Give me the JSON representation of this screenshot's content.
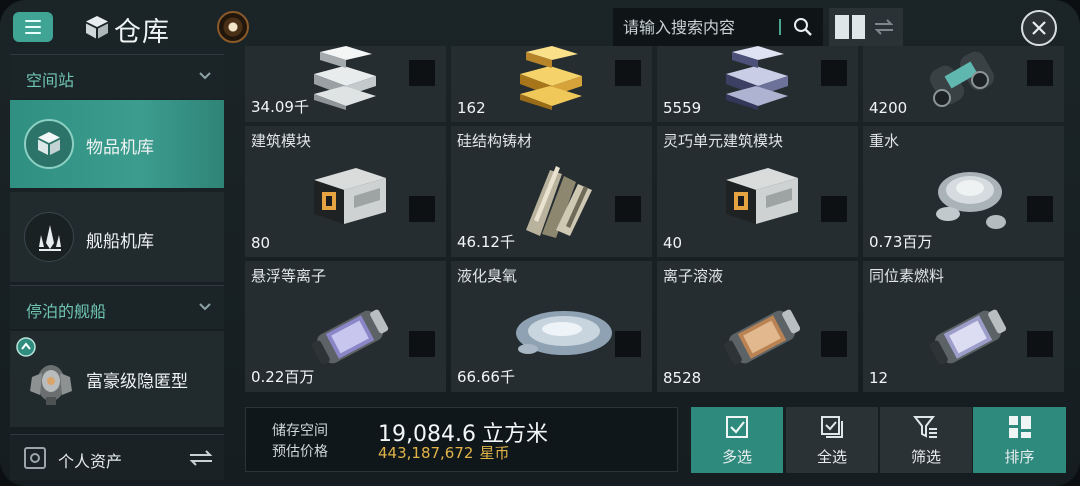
{
  "header": {
    "title": "仓库",
    "search_placeholder": "请输入搜索内容",
    "icons": [
      "menu-icon",
      "cube-icon",
      "radar-icon",
      "search-icon",
      "grid-view-icon",
      "swap-view-icon",
      "close-icon"
    ]
  },
  "sidebar": {
    "section1": "空间站",
    "item_warehouse": "物品机库",
    "item_ships": "舰船机库",
    "section2": "停泊的舰船",
    "item_docked": "富豪级隐匿型",
    "assets": "个人资产"
  },
  "items": [
    {
      "name": "",
      "qty": "34.09千",
      "art": "silver-ingot-icon"
    },
    {
      "name": "",
      "qty": "162",
      "art": "gold-ingot-icon"
    },
    {
      "name": "",
      "qty": "5559",
      "art": "dark-ingot-icon"
    },
    {
      "name": "",
      "qty": "4200",
      "art": "component-icon"
    },
    {
      "name": "建筑模块",
      "qty": "80",
      "art": "module-icon"
    },
    {
      "name": "硅结构铸材",
      "qty": "46.12千",
      "art": "crystal-icon"
    },
    {
      "name": "灵巧单元建筑模块",
      "qty": "40",
      "art": "module-icon"
    },
    {
      "name": "重水",
      "qty": "0.73百万",
      "art": "water-drop-icon"
    },
    {
      "name": "悬浮等离子",
      "qty": "0.22百万",
      "art": "canister-icon"
    },
    {
      "name": "液化臭氧",
      "qty": "66.66千",
      "art": "liquid-puddle-icon"
    },
    {
      "name": "离子溶液",
      "qty": "8528",
      "art": "canister-icon"
    },
    {
      "name": "同位素燃料",
      "qty": "12",
      "art": "canister-icon"
    }
  ],
  "storage": {
    "space_label": "储存空间",
    "space_value": "19,084.6",
    "space_unit": "立方米",
    "price_label": "预估价格",
    "price_value": "443,187,672",
    "price_unit": "星币"
  },
  "actions": {
    "multi": "多选",
    "all": "全选",
    "filter": "筛选",
    "sort": "排序"
  },
  "colors": {
    "accent": "#3c9d8f",
    "price": "#e0b349",
    "cell_bg": "#252d31"
  }
}
